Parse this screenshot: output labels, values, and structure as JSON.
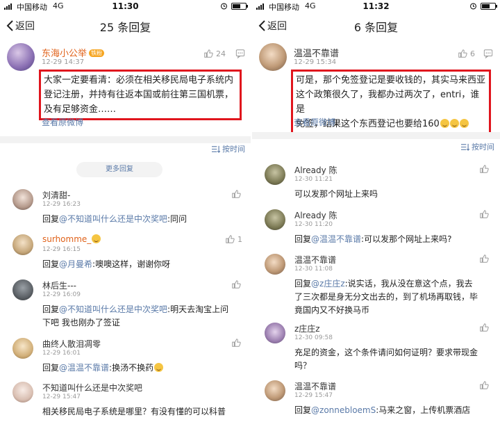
{
  "left": {
    "status": {
      "carrier": "中国移动",
      "network": "4G",
      "time": "11:30"
    },
    "nav": {
      "back_label": "返回",
      "title": "25 条回复"
    },
    "post": {
      "author": "东海小公举",
      "badge": "铁粉",
      "time": "12-29 14:37",
      "likes": "24",
      "text_lines": [
        "大家一定要看清：必须在相关移民局电子系统内",
        "登记注册，并持有往返本国或前往第三国机票，",
        "及有足够资金……"
      ],
      "view_original": "查看原微博"
    },
    "sort_label": "按时间",
    "more_replies": "更多回复",
    "comments": [
      {
        "name": "刘清甜-",
        "time": "12-29 16:23",
        "prefix": "回复",
        "mention": "@不知道叫什么还是中次奖吧",
        "lines": [
          ":同问"
        ],
        "likes": ""
      },
      {
        "name": "surhomme_",
        "time": "12-29 16:15",
        "prefix": "回复",
        "mention": "@月曼希",
        "lines": [
          ":噢噢这样，谢谢你呀"
        ],
        "likes": "1"
      },
      {
        "name": "林后生---",
        "time": "12-29 16:09",
        "prefix": "回复",
        "mention": "@不知道叫什么还是中次奖吧",
        "lines": [
          ":明天去淘宝上问",
          "下吧 我也刚办了签证"
        ],
        "likes": ""
      },
      {
        "name": "曲终人散泪凋零",
        "time": "12-29 16:01",
        "prefix": "回复",
        "mention": "@温温不靠谱",
        "lines": [
          ":换汤不换药"
        ],
        "likes": ""
      },
      {
        "name": "不知道叫什么还是中次奖吧",
        "time": "12-29 15:47",
        "prefix": "",
        "mention": "",
        "lines": [
          "相关移民局电子系统是哪里？有没有懂的可以科普"
        ],
        "likes": ""
      }
    ]
  },
  "right": {
    "status": {
      "carrier": "中国移动",
      "network": "4G",
      "time": "11:32"
    },
    "nav": {
      "back_label": "返回",
      "title": "6 条回复"
    },
    "post": {
      "author": "温温不靠谱",
      "time": "12-29 15:34",
      "likes": "6",
      "text_lines": [
        "可是，那个免签登记是要收钱的，其实马来西亚",
        "这个政策很久了，我都办过两次了，entri，谁是",
        "免签，结果这个东西登记也要给160"
      ],
      "view_original": "查看原微博"
    },
    "sort_label": "按时间",
    "comments": [
      {
        "name": "Already 陈",
        "time": "12-30 11:21",
        "prefix": "",
        "mention": "",
        "lines": [
          "可以发那个网址上来吗"
        ],
        "likes": ""
      },
      {
        "name": "Already 陈",
        "time": "12-30 11:20",
        "prefix": "回复",
        "mention": "@温温不靠谱",
        "lines": [
          ":可以发那个网址上来吗?"
        ],
        "likes": ""
      },
      {
        "name": "温温不靠谱",
        "time": "12-30 11:08",
        "prefix": "回复",
        "mention": "@z庄庄z",
        "lines": [
          ":说实话，我从没在意这个点，我去",
          "了三次都是身无分文出去的，到了机场再取钱，毕",
          "竟国内又不好换马币"
        ],
        "likes": ""
      },
      {
        "name": "z庄庄z",
        "time": "12-30 09:58",
        "prefix": "",
        "mention": "",
        "lines": [
          "充足的资金，这个条件请问如何证明？要求带现金",
          "吗？"
        ],
        "likes": ""
      },
      {
        "name": "温温不靠谱",
        "time": "12-29 15:47",
        "prefix": "回复",
        "mention": "@zonnebloemS",
        "lines": [
          ":马来之窗，上传机票酒店"
        ],
        "likes": ""
      }
    ]
  },
  "colors": {
    "highlight_box": "#e0151d",
    "link": "#5a7aa8",
    "author_orange": "#e0621a"
  },
  "icons": [
    "signal-icon",
    "alarm-icon",
    "battery-icon",
    "back-chevron-icon",
    "thumb-up-icon",
    "message-icon",
    "sort-icon"
  ]
}
